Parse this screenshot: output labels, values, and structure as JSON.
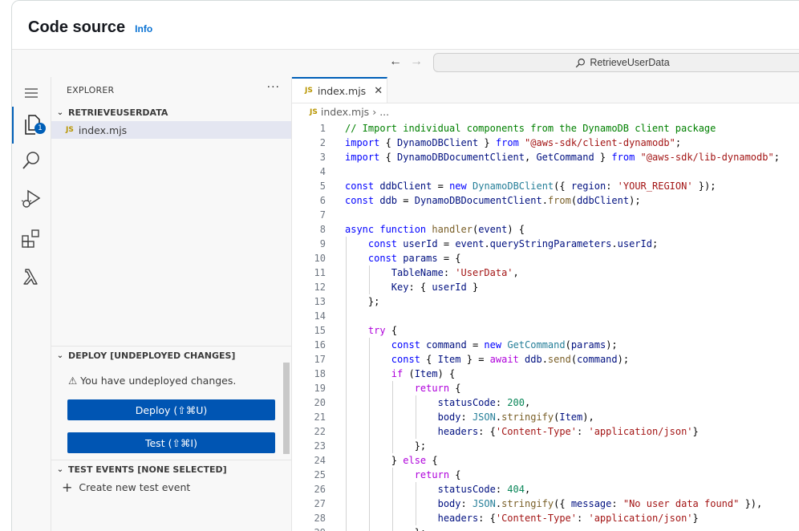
{
  "header": {
    "title": "Code source",
    "info_label": "Info"
  },
  "command_center": {
    "label": "RetrieveUserData"
  },
  "activity_bar": {
    "items": [
      {
        "name": "explorer-icon",
        "badge": "1"
      },
      {
        "name": "search-icon"
      },
      {
        "name": "run-debug-icon"
      },
      {
        "name": "extensions-icon"
      },
      {
        "name": "lambda-icon"
      }
    ]
  },
  "explorer": {
    "title": "EXPLORER",
    "folder": "RETRIEVEUSERDATA",
    "files": [
      {
        "badge": "JS",
        "name": "index.mjs"
      }
    ]
  },
  "deploy": {
    "title": "DEPLOY [UNDEPLOYED CHANGES]",
    "warning": "⚠ You have undeployed changes.",
    "deploy_label": "Deploy (⇧⌘U)",
    "test_label": "Test (⇧⌘I)"
  },
  "test_events": {
    "title": "TEST EVENTS [NONE SELECTED]",
    "create_label": "Create new test event"
  },
  "editor": {
    "tab": {
      "badge": "JS",
      "label": "index.mjs"
    },
    "breadcrumb": {
      "file": "index.mjs",
      "more": "..."
    },
    "lines": [
      [
        [
          "c-cmt",
          "// Import individual components from the DynamoDB client package"
        ]
      ],
      [
        [
          "c-kw",
          "import"
        ],
        [
          "c-txt",
          " { "
        ],
        [
          "c-var",
          "DynamoDBClient"
        ],
        [
          "c-txt",
          " } "
        ],
        [
          "c-kw",
          "from"
        ],
        [
          "c-txt",
          " "
        ],
        [
          "c-str",
          "\"@aws-sdk/client-dynamodb\""
        ],
        [
          "c-txt",
          ";"
        ]
      ],
      [
        [
          "c-kw",
          "import"
        ],
        [
          "c-txt",
          " { "
        ],
        [
          "c-var",
          "DynamoDBDocumentClient"
        ],
        [
          "c-txt",
          ", "
        ],
        [
          "c-var",
          "GetCommand"
        ],
        [
          "c-txt",
          " } "
        ],
        [
          "c-kw",
          "from"
        ],
        [
          "c-txt",
          " "
        ],
        [
          "c-str",
          "\"@aws-sdk/lib-dynamodb\""
        ],
        [
          "c-txt",
          ";"
        ]
      ],
      [],
      [
        [
          "c-kw",
          "const"
        ],
        [
          "c-txt",
          " "
        ],
        [
          "c-var",
          "ddbClient"
        ],
        [
          "c-txt",
          " = "
        ],
        [
          "c-kw",
          "new"
        ],
        [
          "c-txt",
          " "
        ],
        [
          "c-cls",
          "DynamoDBClient"
        ],
        [
          "c-txt",
          "({ "
        ],
        [
          "c-var",
          "region"
        ],
        [
          "c-txt",
          ": "
        ],
        [
          "c-str",
          "'YOUR_REGION'"
        ],
        [
          "c-txt",
          " });"
        ]
      ],
      [
        [
          "c-kw",
          "const"
        ],
        [
          "c-txt",
          " "
        ],
        [
          "c-var",
          "ddb"
        ],
        [
          "c-txt",
          " = "
        ],
        [
          "c-var",
          "DynamoDBDocumentClient"
        ],
        [
          "c-txt",
          "."
        ],
        [
          "c-fn",
          "from"
        ],
        [
          "c-txt",
          "("
        ],
        [
          "c-var",
          "ddbClient"
        ],
        [
          "c-txt",
          ");"
        ]
      ],
      [],
      [
        [
          "c-kw",
          "async"
        ],
        [
          "c-txt",
          " "
        ],
        [
          "c-kw",
          "function"
        ],
        [
          "c-txt",
          " "
        ],
        [
          "c-fn",
          "handler"
        ],
        [
          "c-txt",
          "("
        ],
        [
          "c-var",
          "event"
        ],
        [
          "c-txt",
          ") {"
        ]
      ],
      [
        [
          "c-txt",
          "    "
        ],
        [
          "c-kw",
          "const"
        ],
        [
          "c-txt",
          " "
        ],
        [
          "c-var",
          "userId"
        ],
        [
          "c-txt",
          " = "
        ],
        [
          "c-var",
          "event"
        ],
        [
          "c-txt",
          "."
        ],
        [
          "c-var",
          "queryStringParameters"
        ],
        [
          "c-txt",
          "."
        ],
        [
          "c-var",
          "userId"
        ],
        [
          "c-txt",
          ";"
        ]
      ],
      [
        [
          "c-txt",
          "    "
        ],
        [
          "c-kw",
          "const"
        ],
        [
          "c-txt",
          " "
        ],
        [
          "c-var",
          "params"
        ],
        [
          "c-txt",
          " = {"
        ]
      ],
      [
        [
          "c-txt",
          "        "
        ],
        [
          "c-var",
          "TableName"
        ],
        [
          "c-txt",
          ": "
        ],
        [
          "c-str",
          "'UserData'"
        ],
        [
          "c-txt",
          ","
        ]
      ],
      [
        [
          "c-txt",
          "        "
        ],
        [
          "c-var",
          "Key"
        ],
        [
          "c-txt",
          ": { "
        ],
        [
          "c-var",
          "userId"
        ],
        [
          "c-txt",
          " }"
        ]
      ],
      [
        [
          "c-txt",
          "    };"
        ]
      ],
      [],
      [
        [
          "c-txt",
          "    "
        ],
        [
          "c-ctl",
          "try"
        ],
        [
          "c-txt",
          " {"
        ]
      ],
      [
        [
          "c-txt",
          "        "
        ],
        [
          "c-kw",
          "const"
        ],
        [
          "c-txt",
          " "
        ],
        [
          "c-var",
          "command"
        ],
        [
          "c-txt",
          " = "
        ],
        [
          "c-kw",
          "new"
        ],
        [
          "c-txt",
          " "
        ],
        [
          "c-cls",
          "GetCommand"
        ],
        [
          "c-txt",
          "("
        ],
        [
          "c-var",
          "params"
        ],
        [
          "c-txt",
          ");"
        ]
      ],
      [
        [
          "c-txt",
          "        "
        ],
        [
          "c-kw",
          "const"
        ],
        [
          "c-txt",
          " { "
        ],
        [
          "c-var",
          "Item"
        ],
        [
          "c-txt",
          " } = "
        ],
        [
          "c-ctl",
          "await"
        ],
        [
          "c-txt",
          " "
        ],
        [
          "c-var",
          "ddb"
        ],
        [
          "c-txt",
          "."
        ],
        [
          "c-fn",
          "send"
        ],
        [
          "c-txt",
          "("
        ],
        [
          "c-var",
          "command"
        ],
        [
          "c-txt",
          ");"
        ]
      ],
      [
        [
          "c-txt",
          "        "
        ],
        [
          "c-ctl",
          "if"
        ],
        [
          "c-txt",
          " ("
        ],
        [
          "c-var",
          "Item"
        ],
        [
          "c-txt",
          ") {"
        ]
      ],
      [
        [
          "c-txt",
          "            "
        ],
        [
          "c-ctl",
          "return"
        ],
        [
          "c-txt",
          " {"
        ]
      ],
      [
        [
          "c-txt",
          "                "
        ],
        [
          "c-var",
          "statusCode"
        ],
        [
          "c-txt",
          ": "
        ],
        [
          "c-num",
          "200"
        ],
        [
          "c-txt",
          ","
        ]
      ],
      [
        [
          "c-txt",
          "                "
        ],
        [
          "c-var",
          "body"
        ],
        [
          "c-txt",
          ": "
        ],
        [
          "c-cls",
          "JSON"
        ],
        [
          "c-txt",
          "."
        ],
        [
          "c-fn",
          "stringify"
        ],
        [
          "c-txt",
          "("
        ],
        [
          "c-var",
          "Item"
        ],
        [
          "c-txt",
          "),"
        ]
      ],
      [
        [
          "c-txt",
          "                "
        ],
        [
          "c-var",
          "headers"
        ],
        [
          "c-txt",
          ": {"
        ],
        [
          "c-str",
          "'Content-Type'"
        ],
        [
          "c-txt",
          ": "
        ],
        [
          "c-str",
          "'application/json'"
        ],
        [
          "c-txt",
          "}"
        ]
      ],
      [
        [
          "c-txt",
          "            };"
        ]
      ],
      [
        [
          "c-txt",
          "        } "
        ],
        [
          "c-ctl",
          "else"
        ],
        [
          "c-txt",
          " {"
        ]
      ],
      [
        [
          "c-txt",
          "            "
        ],
        [
          "c-ctl",
          "return"
        ],
        [
          "c-txt",
          " {"
        ]
      ],
      [
        [
          "c-txt",
          "                "
        ],
        [
          "c-var",
          "statusCode"
        ],
        [
          "c-txt",
          ": "
        ],
        [
          "c-num",
          "404"
        ],
        [
          "c-txt",
          ","
        ]
      ],
      [
        [
          "c-txt",
          "                "
        ],
        [
          "c-var",
          "body"
        ],
        [
          "c-txt",
          ": "
        ],
        [
          "c-cls",
          "JSON"
        ],
        [
          "c-txt",
          "."
        ],
        [
          "c-fn",
          "stringify"
        ],
        [
          "c-txt",
          "({ "
        ],
        [
          "c-var",
          "message"
        ],
        [
          "c-txt",
          ": "
        ],
        [
          "c-str",
          "\"No user data found\""
        ],
        [
          "c-txt",
          " }),"
        ]
      ],
      [
        [
          "c-txt",
          "                "
        ],
        [
          "c-var",
          "headers"
        ],
        [
          "c-txt",
          ": {"
        ],
        [
          "c-str",
          "'Content-Type'"
        ],
        [
          "c-txt",
          ": "
        ],
        [
          "c-str",
          "'application/json'"
        ],
        [
          "c-txt",
          "}"
        ]
      ],
      [
        [
          "c-txt",
          "            };"
        ]
      ]
    ]
  }
}
